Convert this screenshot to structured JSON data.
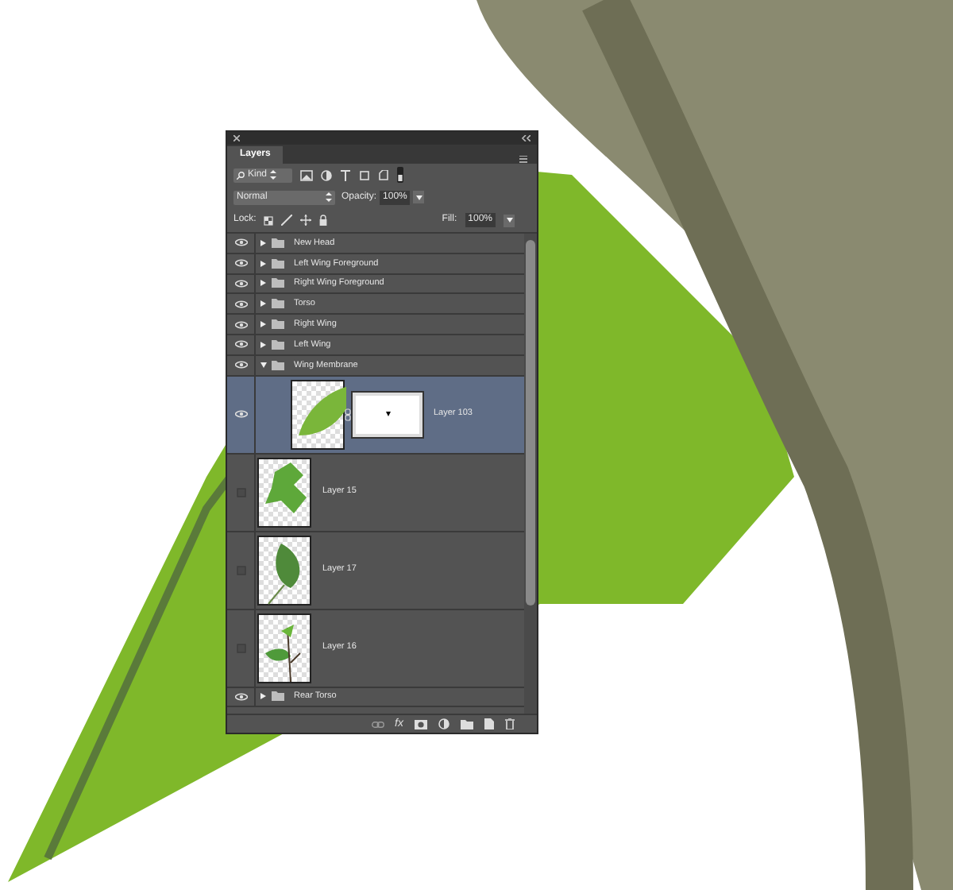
{
  "panel": {
    "tab": {
      "label": "Layers",
      "selected": true
    },
    "filter": {
      "label": "Kind"
    },
    "blend_mode": "Normal",
    "opacity_label": "Opacity:",
    "opacity": "100%",
    "lock_label": "Lock:",
    "fill_label": "Fill:",
    "fill": "100%",
    "layers": [
      {
        "kind": "group",
        "name": "New Head",
        "visible": true,
        "expanded": false,
        "selected": false
      },
      {
        "kind": "group",
        "name": "Left Wing Foreground",
        "visible": true,
        "expanded": false,
        "selected": false
      },
      {
        "kind": "group",
        "name": "Right Wing Foreground",
        "visible": true,
        "expanded": false,
        "selected": false
      },
      {
        "kind": "group",
        "name": "Torso",
        "visible": true,
        "expanded": false,
        "selected": false
      },
      {
        "kind": "group",
        "name": "Right Wing",
        "visible": true,
        "expanded": false,
        "selected": false
      },
      {
        "kind": "group",
        "name": "Left Wing",
        "visible": true,
        "expanded": false,
        "selected": false
      },
      {
        "kind": "group",
        "name": "Wing Membrane",
        "visible": true,
        "expanded": true,
        "selected": false,
        "children": [
          {
            "kind": "layer",
            "name": "Layer 103",
            "visible": true,
            "selected": true,
            "mask": true
          },
          {
            "kind": "layer",
            "name": "Layer 15",
            "visible": false,
            "selected": false,
            "mask": false
          },
          {
            "kind": "layer",
            "name": "Layer 17",
            "visible": false,
            "selected": false,
            "mask": false
          },
          {
            "kind": "layer",
            "name": "Layer 16",
            "visible": false,
            "selected": false,
            "mask": false
          }
        ]
      },
      {
        "kind": "group",
        "name": "Rear Torso",
        "visible": true,
        "expanded": false,
        "selected": false
      }
    ],
    "footer_fx": "fx"
  }
}
